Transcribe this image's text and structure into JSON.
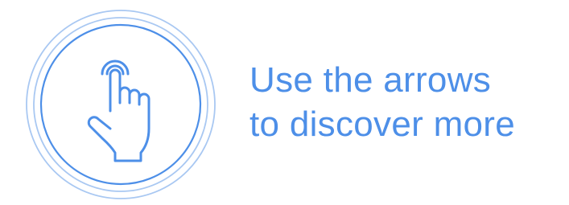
{
  "hint": {
    "line1": "Use the arrows",
    "line2": "to discover more",
    "icon": "tap-hand-icon",
    "accent_color": "#4d8fe8",
    "ring_color": "#a9c8f2"
  }
}
